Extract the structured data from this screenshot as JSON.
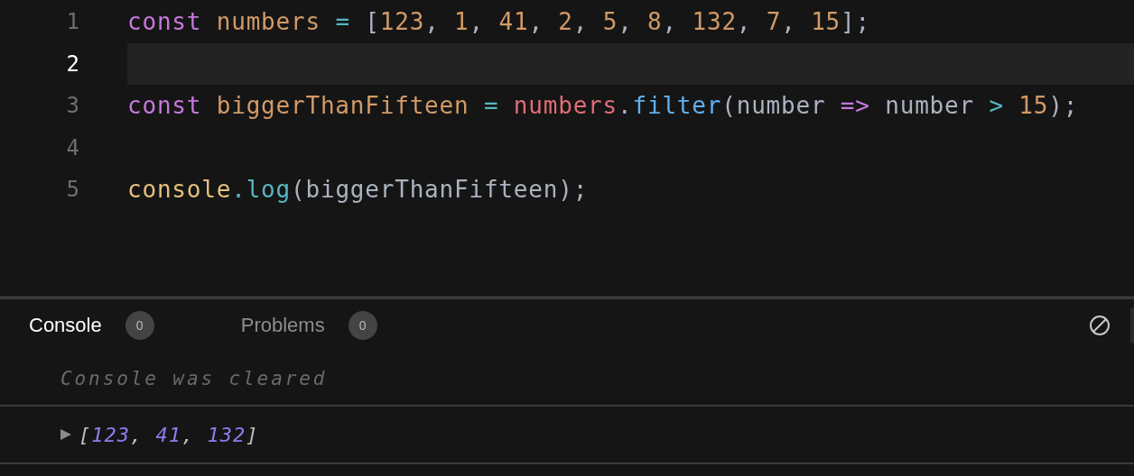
{
  "editor": {
    "lines": [
      {
        "number": "1",
        "current": false,
        "tokens": [
          {
            "text": "const",
            "kind": "keyword"
          },
          {
            "text": " numbers",
            "kind": "variable"
          },
          {
            "text": " =",
            "kind": "operator"
          },
          {
            "text": " [",
            "kind": "punct"
          },
          {
            "text": "123",
            "kind": "number"
          },
          {
            "text": ", ",
            "kind": "punct"
          },
          {
            "text": "1",
            "kind": "number"
          },
          {
            "text": ", ",
            "kind": "punct"
          },
          {
            "text": "41",
            "kind": "number"
          },
          {
            "text": ", ",
            "kind": "punct"
          },
          {
            "text": "2",
            "kind": "number"
          },
          {
            "text": ", ",
            "kind": "punct"
          },
          {
            "text": "5",
            "kind": "number"
          },
          {
            "text": ", ",
            "kind": "punct"
          },
          {
            "text": "8",
            "kind": "number"
          },
          {
            "text": ", ",
            "kind": "punct"
          },
          {
            "text": "132",
            "kind": "number"
          },
          {
            "text": ", ",
            "kind": "punct"
          },
          {
            "text": "7",
            "kind": "number"
          },
          {
            "text": ", ",
            "kind": "punct"
          },
          {
            "text": "15",
            "kind": "number"
          },
          {
            "text": "];",
            "kind": "punct"
          }
        ]
      },
      {
        "number": "2",
        "current": true
      },
      {
        "number": "3",
        "current": false,
        "tokens": [
          {
            "text": "const",
            "kind": "keyword"
          },
          {
            "text": " biggerThanFifteen",
            "kind": "variable"
          },
          {
            "text": " =",
            "kind": "operator"
          },
          {
            "text": " numbers",
            "kind": "object"
          },
          {
            "text": ".",
            "kind": "punct"
          },
          {
            "text": "filter",
            "kind": "method"
          },
          {
            "text": "(number ",
            "kind": "punct"
          },
          {
            "text": "=>",
            "kind": "keyword"
          },
          {
            "text": " number ",
            "kind": "punct"
          },
          {
            "text": ">",
            "kind": "operator"
          },
          {
            "text": " 15",
            "kind": "number"
          },
          {
            "text": ");",
            "kind": "punct"
          }
        ]
      },
      {
        "number": "4",
        "current": false
      },
      {
        "number": "5",
        "current": false,
        "tokens": [
          {
            "text": "console",
            "kind": "global"
          },
          {
            "text": ".log",
            "kind": "method2"
          },
          {
            "text": "(biggerThanFifteen);",
            "kind": "punct"
          }
        ]
      }
    ]
  },
  "panel": {
    "tabs": [
      {
        "label": "Console",
        "count": "0",
        "selected": true
      },
      {
        "label": "Problems",
        "count": "0",
        "selected": false
      }
    ],
    "cleared_message": "Console was cleared",
    "output": {
      "expanded": false,
      "tokens": [
        {
          "text": "[",
          "kind": "bracket"
        },
        {
          "text": "123",
          "kind": "number"
        },
        {
          "text": ", ",
          "kind": "bracket"
        },
        {
          "text": "41",
          "kind": "number"
        },
        {
          "text": ", ",
          "kind": "bracket"
        },
        {
          "text": "132",
          "kind": "number"
        },
        {
          "text": "]",
          "kind": "bracket"
        }
      ]
    }
  }
}
